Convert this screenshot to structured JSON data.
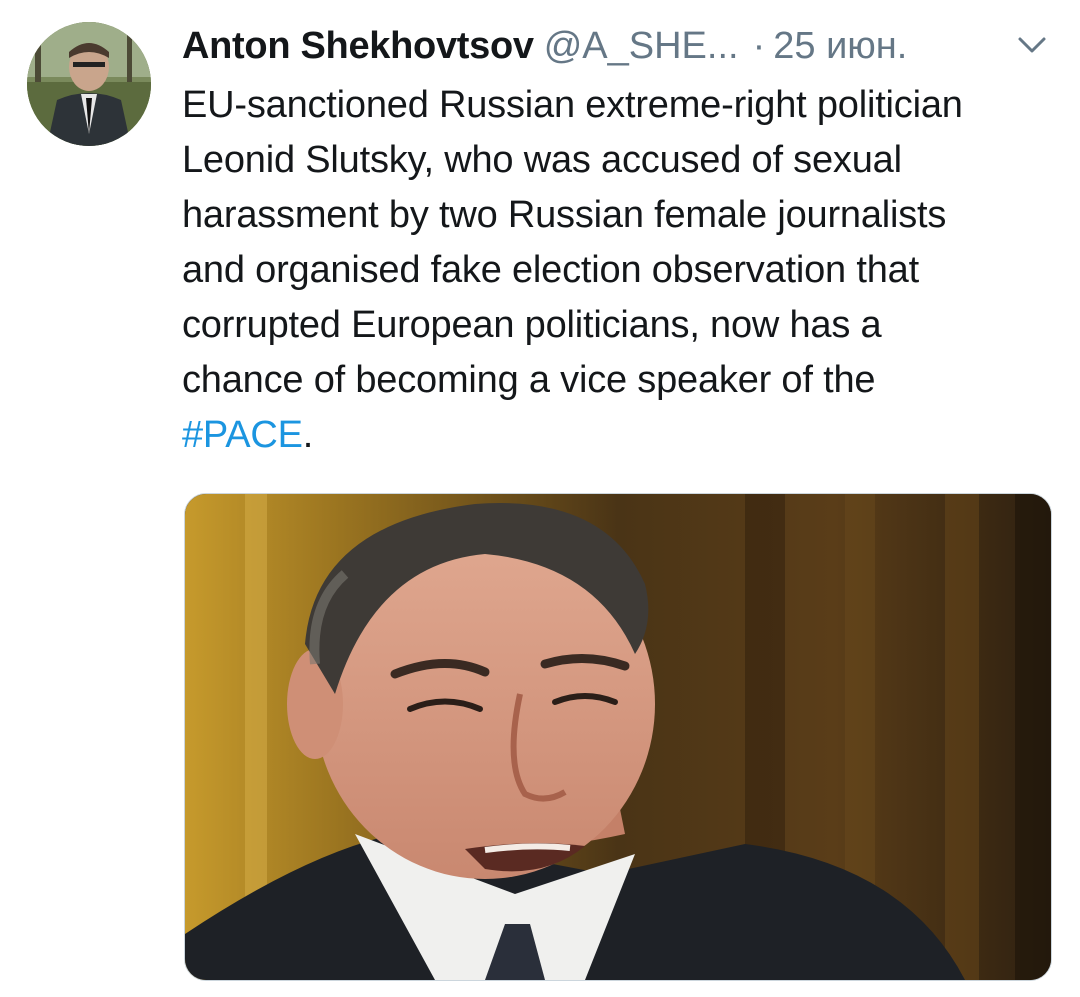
{
  "tweet": {
    "author": {
      "display_name": "Anton Shekhovtsov",
      "handle": "@A_SHE...",
      "avatar_icon": "profile-photo"
    },
    "separator": "·",
    "date": "25 июн.",
    "menu_icon": "chevron-down-icon",
    "text_lines": [
      "EU-sanctioned Russian extreme-right politician",
      "Leonid Slutsky, who was accused of sexual",
      "harassment by two Russian female journalists",
      "and organised fake election observation that",
      "corrupted European politicians, now has a",
      "chance of becoming a vice speaker of the"
    ],
    "hashtag": "#PACE",
    "trailing_punctuation": ".",
    "media": {
      "type": "photo"
    }
  },
  "colors": {
    "text": "#14171a",
    "secondary": "#657786",
    "link": "#1b95e0",
    "border": "#ccd6dd"
  }
}
